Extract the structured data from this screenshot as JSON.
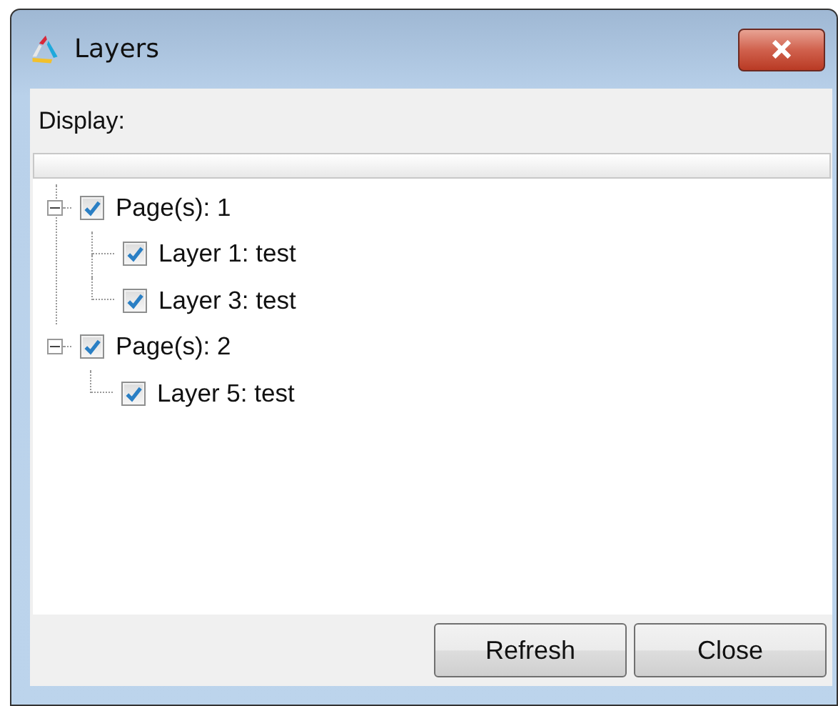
{
  "window": {
    "title": "Layers"
  },
  "display_label": "Display:",
  "tree": [
    {
      "label": "Page(s): 1",
      "checked": true,
      "expanded": true,
      "children": [
        {
          "label": "Layer 1: test",
          "checked": true
        },
        {
          "label": "Layer 3: test",
          "checked": true
        }
      ]
    },
    {
      "label": "Page(s): 2",
      "checked": true,
      "expanded": true,
      "children": [
        {
          "label": "Layer 5: test",
          "checked": true
        }
      ]
    }
  ],
  "buttons": [
    "Refresh",
    "Close"
  ]
}
